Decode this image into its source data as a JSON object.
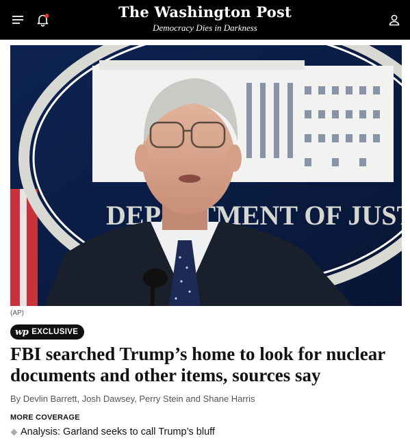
{
  "header": {
    "logo": "The Washington Post",
    "tagline": "Democracy Dies in Darkness",
    "menu_icon": "hamburger-menu-icon",
    "notifications_icon": "bell-icon",
    "account_icon": "user-icon",
    "notification_dot_color": "#e8342a"
  },
  "hero": {
    "image_semantic": "photo-man-speaking-at-justice-department-podium",
    "seal_text": "DEPARTMENT OF JUSTICE",
    "credit": "(AP)"
  },
  "article": {
    "badge_logo": "wp",
    "badge_label": "EXCLUSIVE",
    "headline": "FBI searched Trump’s home to look for nuclear documents and other items, sources say",
    "byline_prefix": "By ",
    "authors": [
      "Devlin Barrett",
      "Josh Dawsey",
      "Perry Stein",
      "Shane Harris"
    ],
    "sep_comma": ", ",
    "sep_and": " and "
  },
  "more_coverage": {
    "label": "MORE COVERAGE",
    "items": [
      {
        "text": "Analysis: Garland seeks to call Trump’s bluff"
      }
    ]
  }
}
